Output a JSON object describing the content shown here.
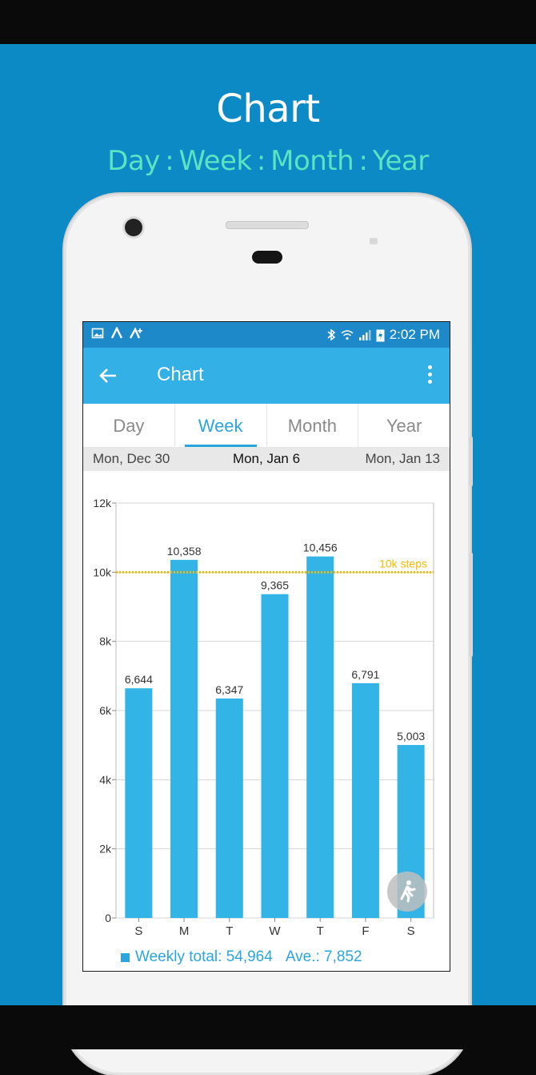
{
  "promo": {
    "title": "Chart",
    "subtitle": "Day : Week : Month : Year",
    "background_color": "#0b8ac6",
    "subtitle_color": "#5be3c2"
  },
  "status_bar": {
    "left_icons": [
      "gallery-icon",
      "notification-a-icon",
      "notification-a-plus-icon"
    ],
    "right_icons": [
      "bluetooth-icon",
      "wifi-icon",
      "signal-icon",
      "battery-charging-icon"
    ],
    "time": "2:02 PM"
  },
  "app_bar": {
    "title": "Chart",
    "color": "#33b0e6"
  },
  "tabs": [
    {
      "label": "Day",
      "active": false
    },
    {
      "label": "Week",
      "active": true
    },
    {
      "label": "Month",
      "active": false
    },
    {
      "label": "Year",
      "active": false
    }
  ],
  "date_nav": {
    "previous": "Mon, Dec 30",
    "current": "Mon, Jan 6",
    "next": "Mon, Jan 13"
  },
  "chart_data": {
    "type": "bar",
    "categories": [
      "S",
      "M",
      "T",
      "W",
      "T",
      "F",
      "S"
    ],
    "values": [
      6644,
      10358,
      6347,
      9365,
      10456,
      6791,
      5003
    ],
    "value_labels": [
      "6,644",
      "10,358",
      "6,347",
      "9,365",
      "10,456",
      "6,791",
      "5,003"
    ],
    "ylim": [
      0,
      12000
    ],
    "yticks": [
      0,
      2000,
      4000,
      6000,
      8000,
      10000,
      12000
    ],
    "ytick_labels": [
      "0",
      "2k",
      "4k",
      "6k",
      "8k",
      "10k",
      "12k"
    ],
    "goal_line": {
      "value": 10000,
      "label": "10k steps",
      "color": "#f7b900"
    },
    "bar_color": "#33b4e6",
    "grid": true
  },
  "legend": {
    "weekly_total": "Weekly total: 54,964",
    "average": "Ave.: 7,852"
  },
  "fab": {
    "icon": "walking-person-icon"
  }
}
